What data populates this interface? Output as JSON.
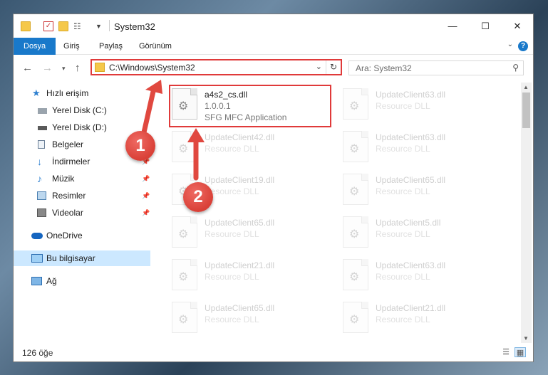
{
  "titlebar": {
    "title": "System32",
    "minimize": "—",
    "maximize": "☐",
    "close": "✕"
  },
  "ribbon": {
    "tabs": [
      "Dosya",
      "Giriş",
      "Paylaş",
      "Görünüm"
    ],
    "help": "?"
  },
  "address": {
    "path": "C:\\Windows\\System32",
    "search_placeholder": "Ara: System32"
  },
  "sidebar": {
    "items": [
      {
        "label": "Hızlı erişim",
        "icon": "star-icon"
      },
      {
        "label": "Yerel Disk (C:)",
        "icon": "drive-icon"
      },
      {
        "label": "Yerel Disk (D:)",
        "icon": "drive-icon"
      },
      {
        "label": "Belgeler",
        "icon": "documents-icon"
      },
      {
        "label": "İndirmeler",
        "icon": "download-icon"
      },
      {
        "label": "Müzik",
        "icon": "music-icon"
      },
      {
        "label": "Resimler",
        "icon": "pictures-icon"
      },
      {
        "label": "Videolar",
        "icon": "videos-icon"
      },
      {
        "label": "OneDrive",
        "icon": "cloud-icon"
      },
      {
        "label": "Bu bilgisayar",
        "icon": "computer-icon"
      },
      {
        "label": "Ağ",
        "icon": "network-icon"
      }
    ]
  },
  "files": {
    "highlighted": {
      "name": "a4s2_cs.dll",
      "version": "1.0.0.1",
      "description": "SFG MFC Application"
    },
    "grid": [
      {
        "name": "UpdateClient63.dll",
        "type": "Resource DLL"
      },
      {
        "name": "UpdateClient42.dll",
        "type": "Resource DLL"
      },
      {
        "name": "UpdateClient63.dll",
        "type": "Resource DLL"
      },
      {
        "name": "UpdateClient19.dll",
        "type": "Resource DLL"
      },
      {
        "name": "UpdateClient65.dll",
        "type": "Resource DLL"
      },
      {
        "name": "UpdateClient65.dll",
        "type": "Resource DLL"
      },
      {
        "name": "UpdateClient5.dll",
        "type": "Resource DLL"
      },
      {
        "name": "UpdateClient21.dll",
        "type": "Resource DLL"
      },
      {
        "name": "UpdateClient63.dll",
        "type": "Resource DLL"
      },
      {
        "name": "UpdateClient65.dll",
        "type": "Resource DLL"
      },
      {
        "name": "UpdateClient21.dll",
        "type": "Resource DLL"
      }
    ]
  },
  "status": {
    "count": "126 öğe"
  },
  "annotations": {
    "one": "1",
    "two": "2"
  },
  "colors": {
    "accent": "#1979ca",
    "highlight": "#e03a3a",
    "selected": "#cce8ff",
    "annotation": "#d94037"
  }
}
